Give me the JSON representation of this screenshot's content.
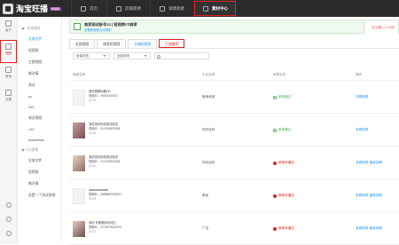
{
  "app": {
    "logo_text": "淘宝旺播",
    "beta": "体验版"
  },
  "topnav": [
    {
      "label": "首页"
    },
    {
      "label": "店铺装修"
    },
    {
      "label": "详情装修"
    },
    {
      "label": "素材中心"
    }
  ],
  "sidebar": [
    {
      "label": "客户"
    },
    {
      "label": "视频"
    },
    {
      "label": "营销"
    },
    {
      "label": "设置"
    }
  ],
  "subnav": {
    "group1": "无线视频",
    "items1": [
      "全部文件",
      "短视频",
      "主图视频",
      "微详情",
      "测试",
      "pc",
      "333",
      "测试视频",
      "123",
      "dsadfwfaw"
    ],
    "group2": "PC视频",
    "items2": [
      "全部文件",
      "短视频",
      "微详情",
      "这是一个测试视频"
    ]
  },
  "card": {
    "title": "商家测试账号14 | 短视频VS商家",
    "sub": "查看短视频合法规则",
    "right_status": "已上线 | 1 | 3:00"
  },
  "tabs": [
    "全部视频",
    "商家短视频",
    "公域短视频",
    "引流推荐"
  ],
  "filters": {
    "sel1": "全部状态",
    "sel2": "全部状态"
  },
  "table": {
    "headers": [
      "视频名称",
      "平台名称",
      "审核状态",
      "操作"
    ],
    "rows": [
      {
        "title": "测试视频标题111",
        "id": "视频ID：25674200017",
        "dur": "00:15",
        "platform": "微淘淘宝",
        "status": "审核通过",
        "status_type": "ok",
        "action": "查看视频"
      },
      {
        "title": "测试测试测试测试测试",
        "id": "视频ID：214743832018",
        "dur": "00:30",
        "platform": "知识百科",
        "status": "审核通过",
        "status_type": "ok",
        "action": "查看视频"
      },
      {
        "title": "测试测试测试测试测试",
        "id": "视频ID：214743832018",
        "dur": "00:20",
        "platform": "知识百科",
        "status": "审核未通过",
        "status_type": "bad",
        "action": "查看视频 重新投稿"
      },
      {
        "title": "aaaaaaaaaaaa",
        "id": "视频ID：2689662082401",
        "dur": "00:25",
        "platform": "美妆",
        "status": "审核未通过",
        "status_type": "bad",
        "action": "查看视频 重新投稿"
      },
      {
        "title": "测试 长视频测试3位1",
        "id": "视频ID：2710075324710",
        "dur": "00:27",
        "platform": "广告",
        "status": "审核未通过",
        "status_type": "bad",
        "action": "查看视频 重新投稿"
      }
    ]
  }
}
